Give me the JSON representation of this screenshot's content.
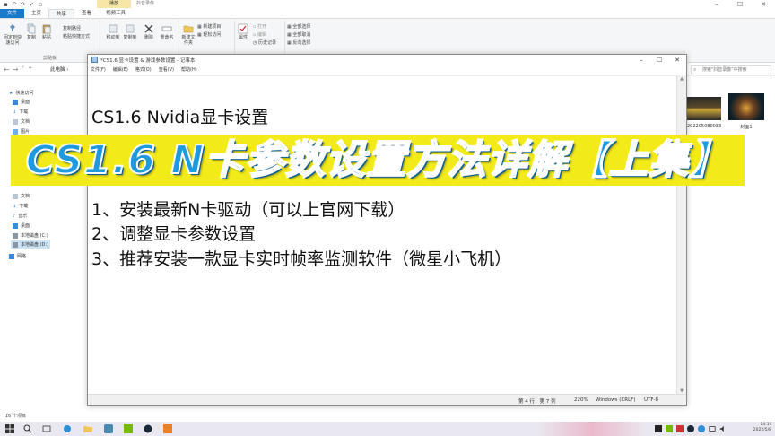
{
  "explorer": {
    "context_tab": "播放",
    "context_title": "抖音录像",
    "tabs": [
      "文件",
      "主页",
      "共享",
      "查看",
      "视频工具"
    ],
    "ribbon": {
      "pin_label": "固定到快速访问",
      "copy_label": "复制",
      "paste_label": "粘贴",
      "copy_path": "复制路径",
      "paste_shortcut": "粘贴快捷方式",
      "clipboard_group": "剪贴板",
      "move_to": "移动到",
      "copy_to": "复制到",
      "delete": "删除",
      "rename": "重命名",
      "new_folder": "新建文件夹",
      "new_item": "新建项目",
      "easy_access": "轻松访问",
      "properties": "属性",
      "open": "打开",
      "edit": "编辑",
      "history": "历史记录",
      "select_all": "全部选择",
      "select_none": "全部取消",
      "invert_selection": "反向选择"
    },
    "address": {
      "path": "此电脑 ›",
      "search_placeholder": "搜索\"抖音录像\"中搜索"
    },
    "nav": {
      "quick_access": "快速访问",
      "items": [
        "桌面",
        "下载",
        "文档",
        "图片"
      ],
      "this_pc_items": [
        "文档",
        "下载",
        "音乐",
        "桌面",
        "本地磁盘 (C:)",
        "本地磁盘 (D:)"
      ],
      "network": "网络"
    },
    "thumbs": [
      {
        "caption": "202205080033"
      },
      {
        "caption": "封面1"
      }
    ],
    "status": "16 个项目"
  },
  "notepad": {
    "title": "*CS1.6 显卡设置 & 游戏参数设置 - 记事本",
    "menu": [
      "文件(F)",
      "编辑(E)",
      "格式(O)",
      "查看(V)",
      "帮助(H)"
    ],
    "lines": [
      "CS1.6 Nvidia显卡设置",
      "1、安装最新N卡驱动（可以上官网下载）",
      "2、调整显卡参数设置",
      "3、推荐安装一款显卡实时帧率监测软件（微星小飞机）"
    ],
    "status": {
      "position": "第 4 行，第 7 列",
      "zoom": "220%",
      "line_ending": "Windows (CRLF)",
      "encoding": "UTF-8"
    }
  },
  "banner": {
    "text": "CS1.6 N卡参数设置方法详解【上集】"
  },
  "taskbar": {
    "tray_time": "14:1?",
    "tray_date": "2022/5/8"
  },
  "colors": {
    "banner_bg": "#f3ea1a",
    "banner_text": "#1f9adf",
    "file_tab": "#1979ca",
    "context_tab": "#f6e7a6"
  }
}
